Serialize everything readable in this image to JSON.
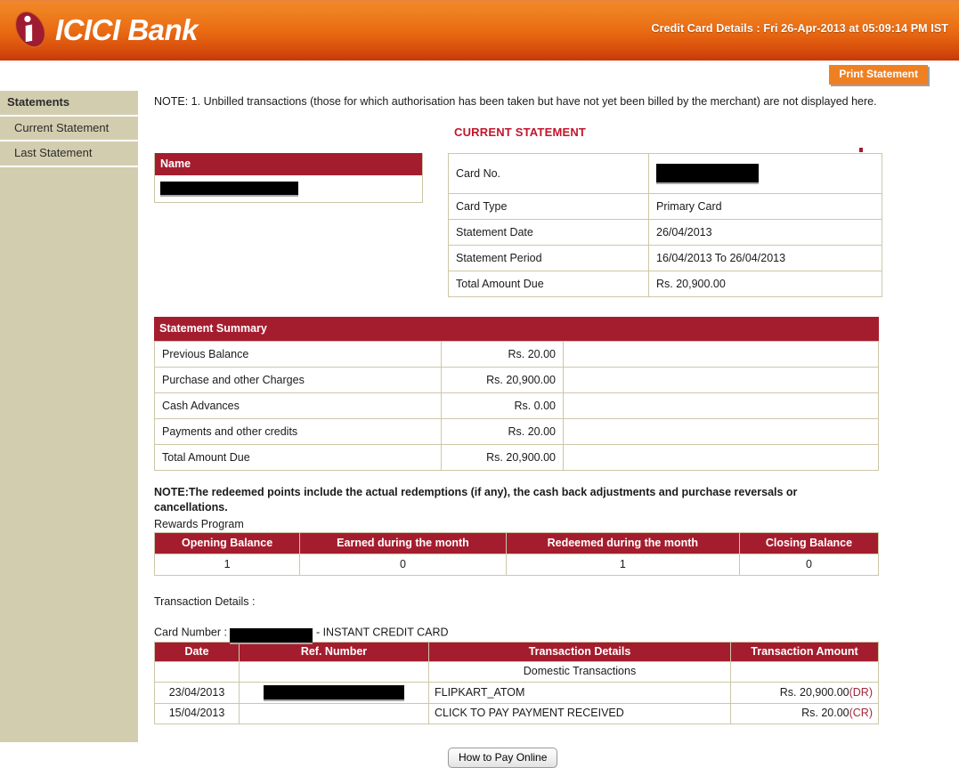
{
  "header": {
    "logo_icon": "icici-logo-icon",
    "brand_primary": "ICICI",
    "brand_secondary": " Bank",
    "title": "Credit Card Details : Fri 26-Apr-2013 at 05:09:14 PM IST",
    "accent_orange": "#ef7f1f",
    "accent_maroon": "#a41d2e"
  },
  "toolbar": {
    "print_label": "Print Statement"
  },
  "sidebar": {
    "heading": "Statements",
    "items": [
      {
        "label": "Current Statement"
      },
      {
        "label": "Last Statement"
      }
    ]
  },
  "main": {
    "note_top": "NOTE: 1. Unbilled transactions (those for which authorisation has been taken but have not yet been billed by the merchant) are not displayed here.",
    "current_statement_title": "CURRENT STATEMENT",
    "name_box": {
      "header": "Name",
      "value_redacted": ""
    },
    "card_details": {
      "rows": [
        {
          "label": "Card No.",
          "value": ""
        },
        {
          "label": "Card Type",
          "value": "Primary Card"
        },
        {
          "label": "Statement Date",
          "value": "26/04/2013"
        },
        {
          "label": "Statement Period",
          "value": "16/04/2013 To 26/04/2013"
        },
        {
          "label": "Total Amount Due",
          "value": "Rs. 20,900.00"
        }
      ]
    },
    "statement_summary": {
      "header": "Statement Summary",
      "rows": [
        {
          "label": "Previous Balance",
          "amount": "Rs. 20.00"
        },
        {
          "label": "Purchase and other Charges",
          "amount": "Rs. 20,900.00"
        },
        {
          "label": "Cash Advances",
          "amount": "Rs. 0.00"
        },
        {
          "label": "Payments and other credits",
          "amount": "Rs. 20.00"
        },
        {
          "label": "Total Amount Due",
          "amount": "Rs. 20,900.00"
        }
      ]
    },
    "rewards": {
      "note": "NOTE:The redeemed points include the actual redemptions (if any), the cash back adjustments and purchase reversals or cancellations.",
      "section_label": "Rewards Program",
      "headers": [
        "Opening Balance",
        "Earned during the month",
        "Redeemed during the month",
        "Closing Balance"
      ],
      "values": [
        "1",
        "0",
        "1",
        "0"
      ]
    },
    "transactions": {
      "title": "Transaction Details :",
      "card_number_label": "Card Number : ",
      "card_number_suffix": "- INSTANT CREDIT CARD",
      "headers": [
        "Date",
        "Ref. Number",
        "Transaction Details",
        "Transaction Amount"
      ],
      "group_row": "Domestic Transactions",
      "rows": [
        {
          "date": "23/04/2013",
          "ref": "",
          "details": "FLIPKART_ATOM",
          "amount": "Rs. 20,900.00",
          "drcr": "(DR)"
        },
        {
          "date": "15/04/2013",
          "ref": "",
          "details": "CLICK TO PAY PAYMENT RECEIVED",
          "amount": "Rs. 20.00",
          "drcr": "(CR)"
        }
      ]
    },
    "footer": {
      "pay_label": "How to Pay Online"
    }
  }
}
